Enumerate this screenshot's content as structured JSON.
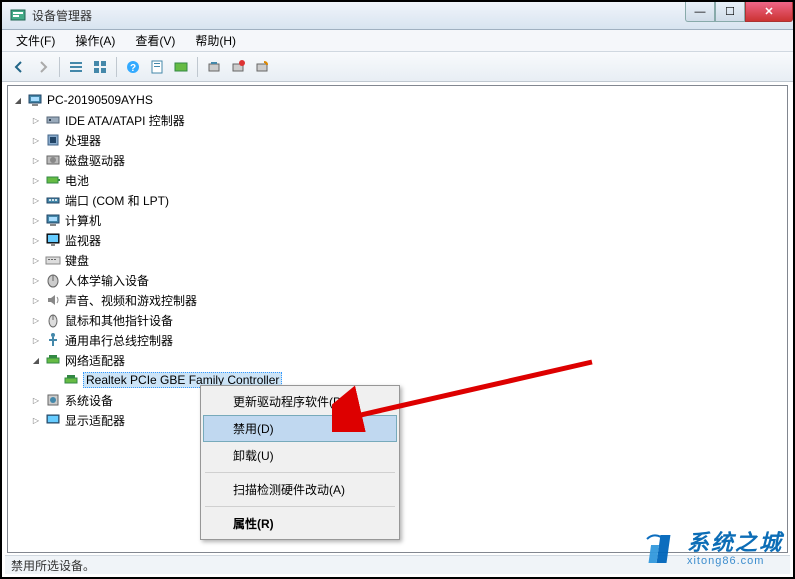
{
  "window": {
    "title": "设备管理器"
  },
  "menubar": {
    "file": "文件(F)",
    "action": "操作(A)",
    "view": "查看(V)",
    "help": "帮助(H)"
  },
  "tree": {
    "root": "PC-20190509AYHS",
    "categories": [
      {
        "label": "IDE ATA/ATAPI 控制器",
        "icon": "ide"
      },
      {
        "label": "处理器",
        "icon": "cpu"
      },
      {
        "label": "磁盘驱动器",
        "icon": "disk"
      },
      {
        "label": "电池",
        "icon": "battery"
      },
      {
        "label": "端口 (COM 和 LPT)",
        "icon": "port"
      },
      {
        "label": "计算机",
        "icon": "computer"
      },
      {
        "label": "监视器",
        "icon": "monitor"
      },
      {
        "label": "键盘",
        "icon": "keyboard"
      },
      {
        "label": "人体学输入设备",
        "icon": "hid"
      },
      {
        "label": "声音、视频和游戏控制器",
        "icon": "sound"
      },
      {
        "label": "鼠标和其他指针设备",
        "icon": "mouse"
      },
      {
        "label": "通用串行总线控制器",
        "icon": "usb"
      },
      {
        "label": "网络适配器",
        "icon": "network",
        "expanded": true,
        "children": [
          {
            "label": "Realtek PCIe GBE Family Controller",
            "icon": "nic",
            "selected": true
          }
        ]
      },
      {
        "label": "系统设备",
        "icon": "system"
      },
      {
        "label": "显示适配器",
        "icon": "display"
      }
    ]
  },
  "context_menu": {
    "update_driver": "更新驱动程序软件(P)...",
    "disable": "禁用(D)",
    "uninstall": "卸载(U)",
    "scan": "扫描检测硬件改动(A)",
    "properties": "属性(R)"
  },
  "statusbar": {
    "text": "禁用所选设备。"
  },
  "watermark": {
    "main": "系统之城",
    "sub": "xitong86.com"
  }
}
